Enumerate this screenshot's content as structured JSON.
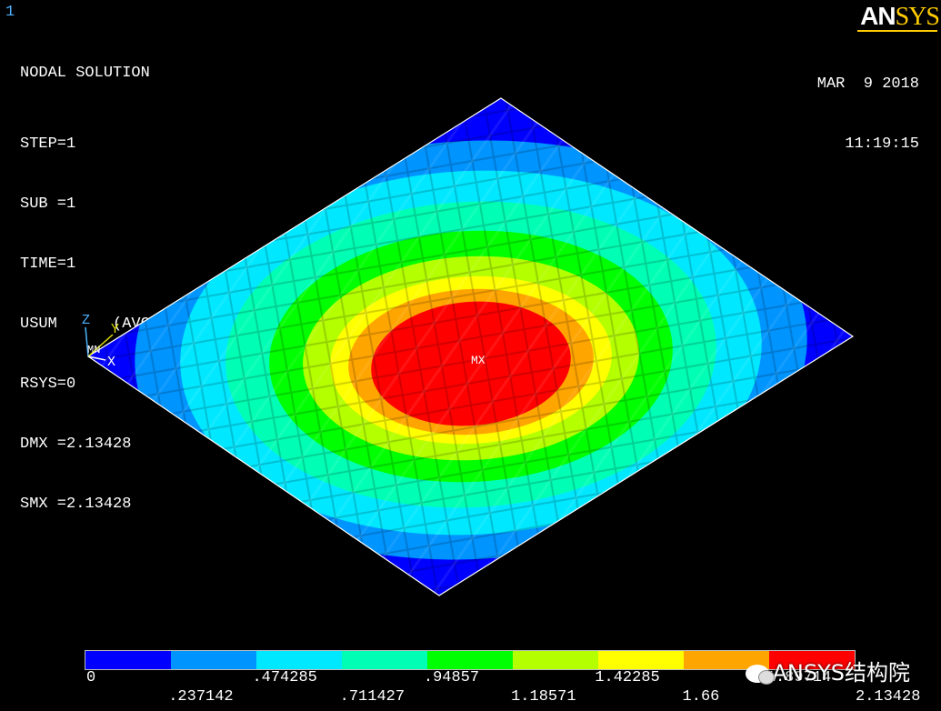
{
  "window_number": "1",
  "logo": {
    "prefix": "AN",
    "suffix": "SYS"
  },
  "info": {
    "title": "NODAL SOLUTION",
    "step": "STEP=1",
    "sub": "SUB =1",
    "time": "TIME=1",
    "usum": "USUM      (AVG)",
    "rsys": "RSYS=0",
    "dmx": "DMX =2.13428",
    "smx": "SMX =2.13428"
  },
  "date": {
    "day": "MAR  9 2018",
    "time": "11:19:15"
  },
  "triad": {
    "z": "Z",
    "y": "Y",
    "mn": "MN",
    "x": "X"
  },
  "mx_label": "MX",
  "contour": {
    "min": 0,
    "max": 2.13428,
    "colors": [
      "#0000ff",
      "#0094ff",
      "#00e8ff",
      "#00ffb4",
      "#00ff00",
      "#b4ff00",
      "#ffff00",
      "#ffa500",
      "#ff0000"
    ],
    "labels_top": [
      "0",
      ".474285",
      ".94857",
      "1.42285",
      "1.89714"
    ],
    "labels_bottom": [
      ".237142",
      ".711427",
      "1.18571",
      "1.66",
      "2.13428"
    ]
  },
  "watermark": "ANSYS结构院"
}
